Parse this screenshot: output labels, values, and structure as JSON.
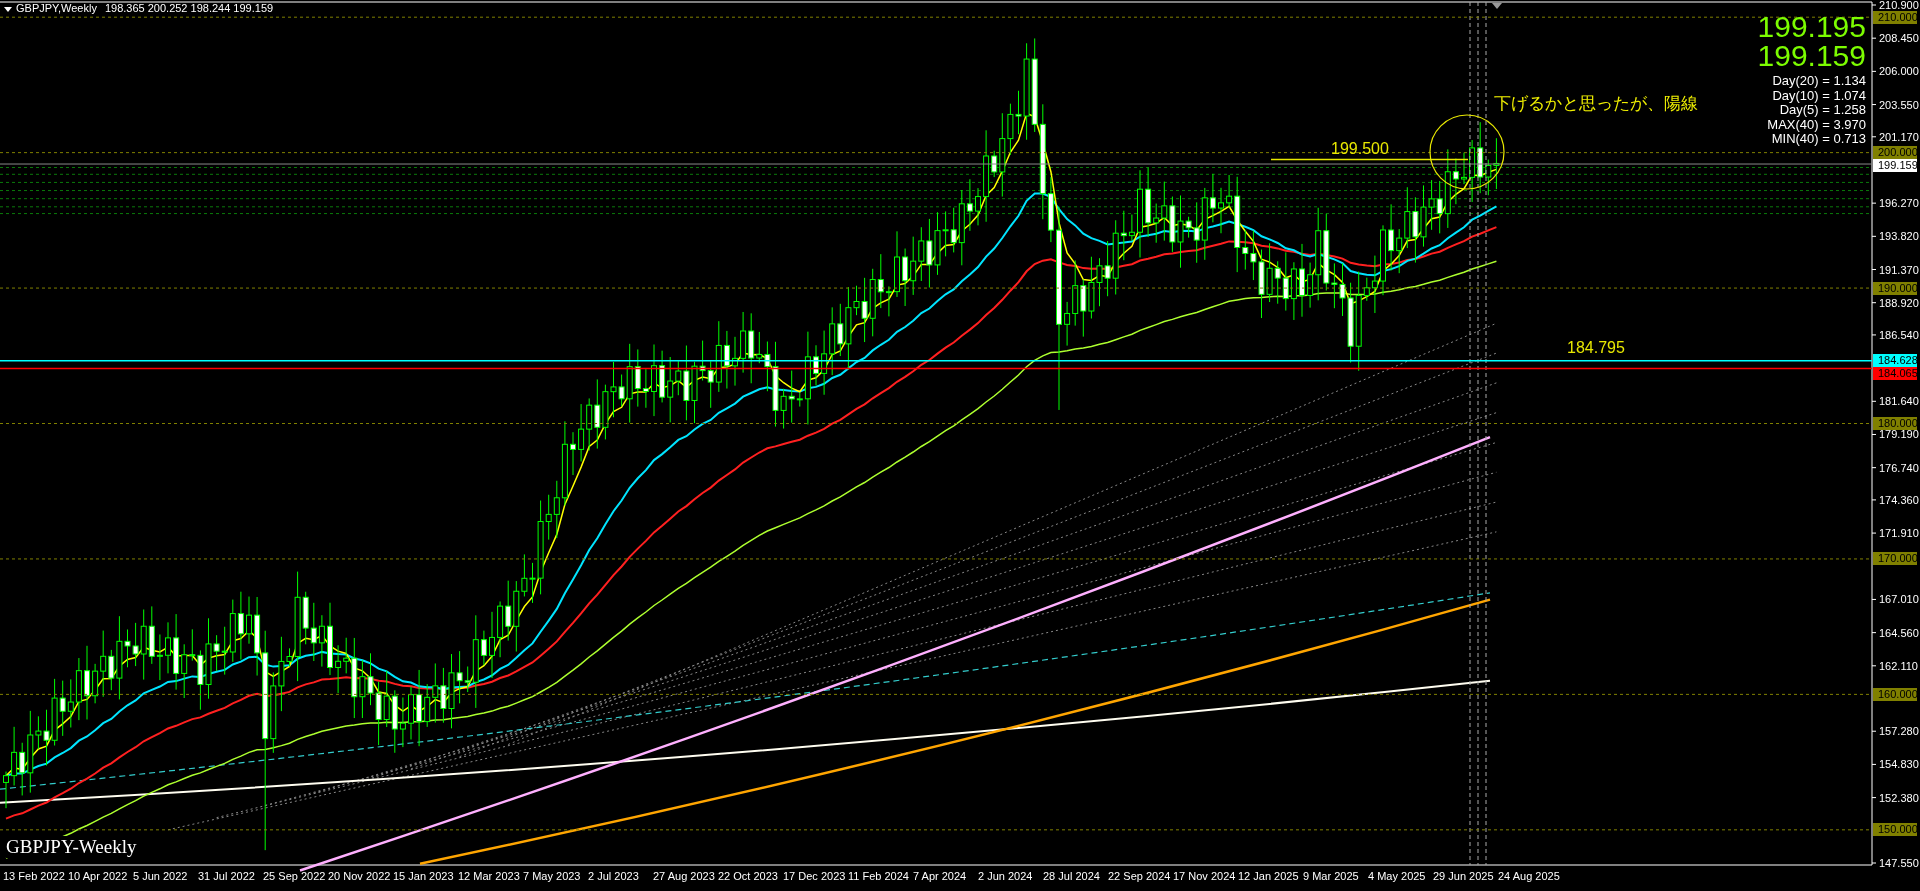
{
  "header": {
    "symbol": "GBPJPY,Weekly",
    "ohlc": "198.365 200.252 198.244 199.159"
  },
  "price_display": {
    "bid": "199.195",
    "last": "199.159"
  },
  "stats": [
    "Day(20) = 1.134",
    "Day(10) = 1.074",
    "Day(5) = 1.258",
    "MAX(40) = 3.970",
    "MIN(40) = 0.713"
  ],
  "comment": "下げるかと思ったが、陽線",
  "annotations": [
    {
      "kind": "yellow-level",
      "text": "199.500"
    },
    {
      "kind": "cyan-level",
      "text": "184.795"
    }
  ],
  "price_axis": {
    "ticks": [
      "210.900",
      "208.450",
      "206.000",
      "203.550",
      "201.170",
      "196.270",
      "193.820",
      "191.370",
      "188.920",
      "186.540",
      "181.640",
      "179.190",
      "176.740",
      "174.360",
      "171.910",
      "167.010",
      "164.560",
      "162.110",
      "157.280",
      "154.830",
      "152.380",
      "147.550"
    ],
    "tags": [
      {
        "kind": "round",
        "text": "210.000"
      },
      {
        "kind": "round",
        "text": "200.000"
      },
      {
        "kind": "bid",
        "text": "199.159"
      },
      {
        "kind": "round",
        "text": "190.000"
      },
      {
        "kind": "cyan-line",
        "text": "184.628"
      },
      {
        "kind": "red-line",
        "text": "184.065"
      },
      {
        "kind": "round",
        "text": "180.000"
      },
      {
        "kind": "round",
        "text": "170.000"
      },
      {
        "kind": "round",
        "text": "160.000"
      },
      {
        "kind": "round",
        "text": "150.000"
      }
    ]
  },
  "time_axis": [
    "13 Feb 2022",
    "10 Apr 2022",
    "5 Jun 2022",
    "31 Jul 2022",
    "25 Sep 2022",
    "20 Nov 2022",
    "15 Jan 2023",
    "12 Mar 2023",
    "7 May 2023",
    "2 Jul 2023",
    "27 Aug 2023",
    "22 Oct 2023",
    "17 Dec 2023",
    "11 Feb 2024",
    "7 Apr 2024",
    "2 Jun 2024",
    "28 Jul 2024",
    "22 Sep 2024",
    "17 Nov 2024",
    "12 Jan 2025",
    "9 Mar 2025",
    "4 May 2025",
    "29 Jun 2025",
    "24 Aug 2025"
  ],
  "chart_label": "GBPJPY-Weekly"
}
